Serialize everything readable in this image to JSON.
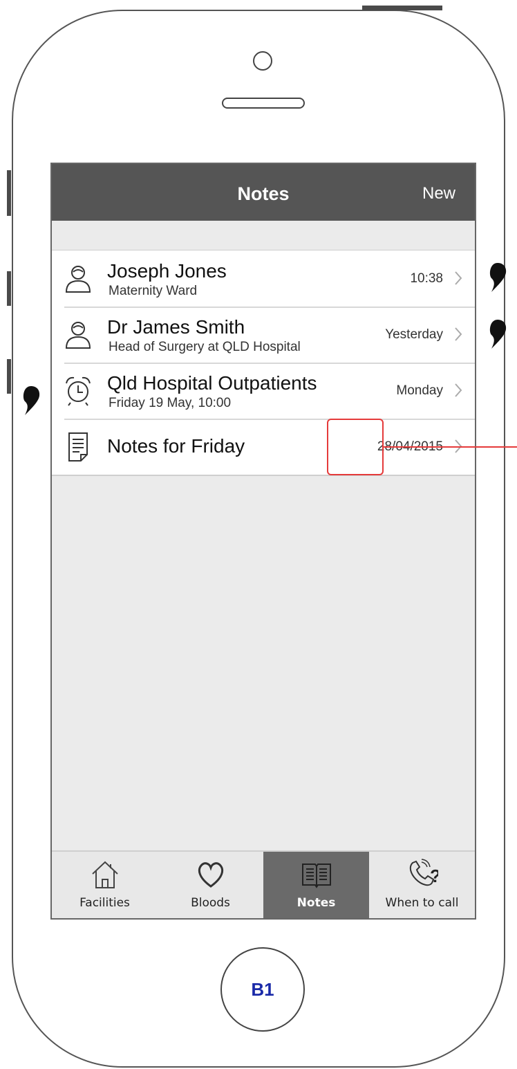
{
  "navbar": {
    "title": "Notes",
    "new_label": "New"
  },
  "notes": [
    {
      "icon": "person-icon",
      "title": "Joseph Jones",
      "subtitle": "Maternity Ward",
      "meta": "10:38"
    },
    {
      "icon": "person-icon",
      "title": "Dr James Smith",
      "subtitle": "Head of Surgery at QLD Hospital",
      "meta": "Yesterday"
    },
    {
      "icon": "alarm-clock-icon",
      "title": "Qld Hospital Outpatients",
      "subtitle": "Friday 19 May, 10:00",
      "meta": "Monday"
    },
    {
      "icon": "document-icon",
      "title": "Notes for Friday",
      "subtitle": "",
      "meta": "28/04/2015"
    }
  ],
  "tabs": [
    {
      "icon": "house-icon",
      "label": "Facilities",
      "active": false
    },
    {
      "icon": "heart-icon",
      "label": "Bloods",
      "active": false
    },
    {
      "icon": "book-icon",
      "label": "Notes",
      "active": true
    },
    {
      "icon": "phone-question-icon",
      "label": "When to call",
      "active": false
    }
  ],
  "home_button_label": "B1",
  "colors": {
    "navbar": "#555555",
    "active_tab": "#6a6a6a",
    "callout": "#e53a3a",
    "home_label": "#1a2aa8"
  }
}
